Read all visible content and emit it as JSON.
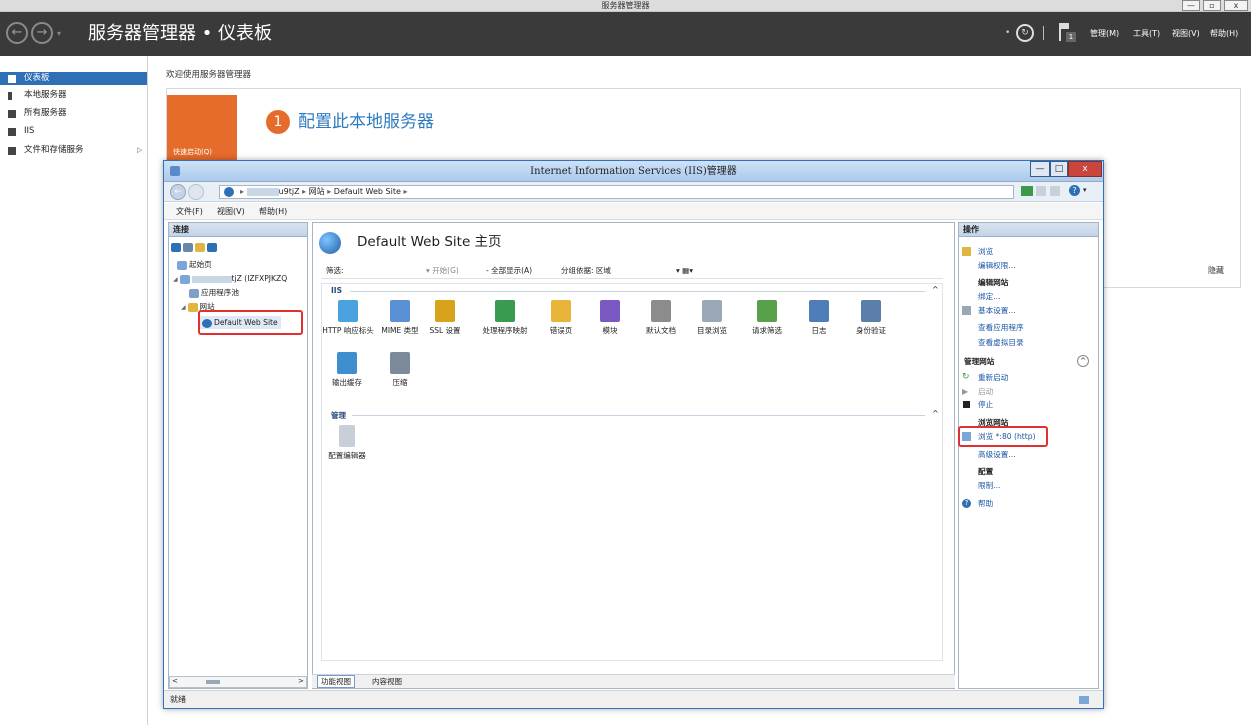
{
  "server_manager": {
    "window_title": "服务器管理器",
    "title": "服务器管理器 • 仪表板",
    "menu": [
      "管理(M)",
      "工具(T)",
      "视图(V)",
      "帮助(H)"
    ],
    "flag_badge": "1",
    "sidebar": [
      {
        "label": "仪表板",
        "selected": true
      },
      {
        "label": "本地服务器"
      },
      {
        "label": "所有服务器"
      },
      {
        "label": "IIS"
      },
      {
        "label": "文件和存储服务"
      }
    ],
    "sidebar_arrow": "▷",
    "welcome": "欢迎使用服务器管理器",
    "quick_start": "快速启动(Q)",
    "step_number": "1",
    "step_text": "配置此本地服务器",
    "hide": "隐藏"
  },
  "iis": {
    "title": "Internet Information Services (IIS)管理器",
    "address": [
      "u9tjZ",
      "网站",
      "Default Web Site"
    ],
    "menu": [
      "文件(F)",
      "视图(V)",
      "帮助(H)"
    ],
    "connections": {
      "header": "连接",
      "tree": [
        "起始页",
        "tjZ (IZFXPJKZQ",
        "应用程序池",
        "网站",
        "Default Web Site"
      ]
    },
    "main": {
      "title": "Default Web Site 主页",
      "filter_label": "筛选:",
      "go_label": "▾ 开始(G)",
      "show_all": "- 全部显示(A)",
      "group_by": "分组依据: 区域",
      "group_iis": "IIS",
      "group_manage": "管理",
      "features": [
        {
          "label": "HTTP 响应标头",
          "color": "#4aa3df"
        },
        {
          "label": "MIME 类型",
          "color": "#5b8fd6"
        },
        {
          "label": "SSL 设置",
          "color": "#d8a21b"
        },
        {
          "label": "处理程序映射",
          "color": "#3b9a52"
        },
        {
          "label": "错误页",
          "color": "#e9b43a"
        },
        {
          "label": "模块",
          "color": "#7a59c2"
        },
        {
          "label": "默认文档",
          "color": "#8c8c8c"
        },
        {
          "label": "目录浏览",
          "color": "#9aa7b6"
        },
        {
          "label": "请求筛选",
          "color": "#58a04a"
        },
        {
          "label": "日志",
          "color": "#4f7db8"
        },
        {
          "label": "身份验证",
          "color": "#5b7fa8"
        },
        {
          "label": "输出缓存",
          "color": "#3f8fd0"
        },
        {
          "label": "压缩",
          "color": "#7d8a99"
        }
      ],
      "manage_features": [
        {
          "label": "配置编辑器",
          "color": "#9aa7b6"
        }
      ],
      "tab_features": "功能视图",
      "tab_content": "内容视图"
    },
    "actions": {
      "header": "操作",
      "browse": "浏览",
      "edit_permissions": "编辑权限...",
      "edit_site": "编辑网站",
      "bindings": "绑定...",
      "basic_settings": "基本设置...",
      "view_apps": "查看应用程序",
      "view_vdirs": "查看虚拟目录",
      "manage_site": "管理网站",
      "restart": "重新启动",
      "start": "启动",
      "stop": "停止",
      "browse_site": "浏览网站",
      "browse_80": "浏览 *:80 (http)",
      "advanced": "高级设置...",
      "config": "配置",
      "limits": "限制...",
      "help": "帮助"
    },
    "status": "就绪"
  }
}
